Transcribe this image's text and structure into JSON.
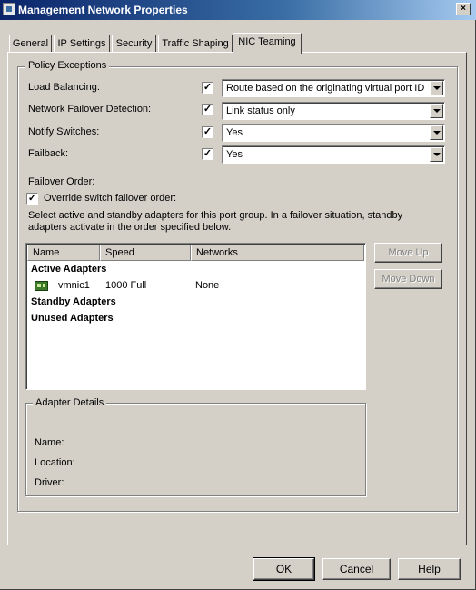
{
  "window": {
    "title": "Management Network Properties",
    "close_label": "×"
  },
  "tabs": [
    {
      "label": "General",
      "active": false
    },
    {
      "label": "IP Settings",
      "active": false
    },
    {
      "label": "Security",
      "active": false
    },
    {
      "label": "Traffic Shaping",
      "active": false
    },
    {
      "label": "NIC Teaming",
      "active": true
    }
  ],
  "policy_exceptions": {
    "legend": "Policy Exceptions",
    "rows": [
      {
        "label": "Load Balancing:",
        "override_checked": true,
        "value": "Route based on the originating virtual port ID"
      },
      {
        "label": "Network Failover Detection:",
        "override_checked": true,
        "value": "Link status only"
      },
      {
        "label": "Notify Switches:",
        "override_checked": true,
        "value": "Yes"
      },
      {
        "label": "Failback:",
        "override_checked": true,
        "value": "Yes"
      }
    ],
    "check_mark": "✓"
  },
  "failover_order": {
    "label": "Failover Order:",
    "override_label": "Override switch failover order:",
    "override_checked": true,
    "instructions_line1": "Select active and standby adapters for this port group.  In a failover situation, standby",
    "instructions_line2": "adapters activate  in the order specified below."
  },
  "adapter_list": {
    "columns": [
      "Name",
      "Speed",
      "Networks"
    ],
    "groups": {
      "active": "Active Adapters",
      "standby": "Standby Adapters",
      "unused": "Unused Adapters"
    },
    "active_adapters": [
      {
        "name": "vmnic1",
        "speed": "1000 Full",
        "networks": "None"
      }
    ]
  },
  "move_buttons": {
    "up": "Move Up",
    "down": "Move Down"
  },
  "adapter_details": {
    "legend": "Adapter Details",
    "name_label": "Name:",
    "location_label": "Location:",
    "driver_label": "Driver:"
  },
  "dialog_buttons": {
    "ok": "OK",
    "cancel": "Cancel",
    "help": "Help"
  },
  "colors": {
    "titlebar_start": "#0a246a",
    "face": "#d4d0c8",
    "nic_icon": "#3c7a2a"
  }
}
